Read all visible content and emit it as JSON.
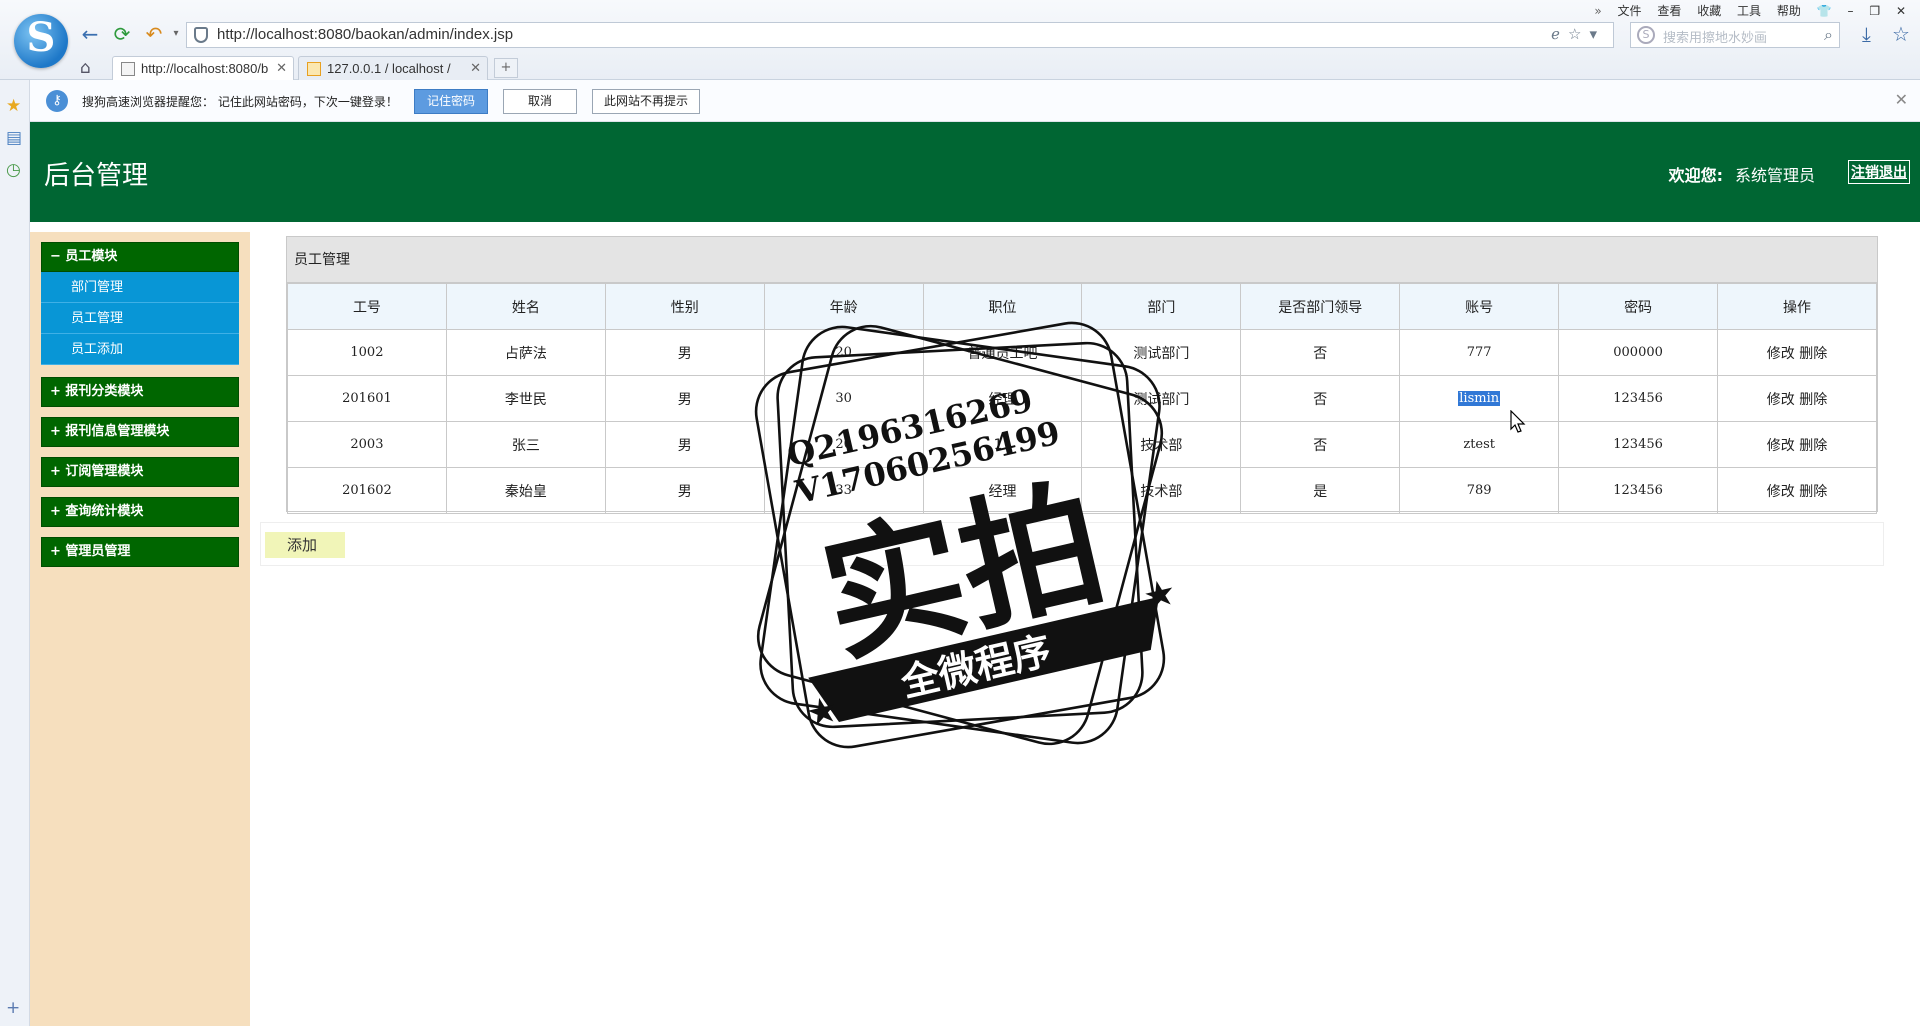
{
  "browser": {
    "url": "http://localhost:8080/baokan/admin/index.jsp",
    "search_placeholder": "搜索用擦地水妙画",
    "menu": [
      "文件",
      "查看",
      "收藏",
      "工具",
      "帮助"
    ],
    "tabs": [
      {
        "label": "http://localhost:8080/b",
        "active": true
      },
      {
        "label": "127.0.0.1 / localhost /",
        "active": false
      }
    ]
  },
  "notification": {
    "text": "搜狗高速浏览器提醒您： 记住此网站密码，下次一键登录！",
    "remember_label": "记住密码",
    "cancel_label": "取消",
    "never_label": "此网站不再提示"
  },
  "header": {
    "title": "后台管理",
    "welcome_label": "欢迎您:",
    "username": "系统管理员",
    "logout_label": "注销退出"
  },
  "sidebar": {
    "groups": [
      {
        "label": "− 员工模块",
        "items": [
          "部门管理",
          "员工管理",
          "员工添加"
        ]
      },
      {
        "label": "+ 报刊分类模块"
      },
      {
        "label": "+ 报刊信息管理模块"
      },
      {
        "label": "+ 订阅管理模块"
      },
      {
        "label": "+ 查询统计模块"
      },
      {
        "label": "+ 管理员管理"
      }
    ]
  },
  "main": {
    "panel_title": "员工管理",
    "columns": [
      "工号",
      "姓名",
      "性别",
      "年龄",
      "职位",
      "部门",
      "是否部门领导",
      "账号",
      "密码",
      "操作"
    ],
    "rows": [
      {
        "id": "1002",
        "name": "占萨法",
        "gender": "男",
        "age": "20",
        "position": "普通员工吧",
        "dept": "测试部门",
        "leader": "否",
        "account": "777",
        "password": "000000"
      },
      {
        "id": "201601",
        "name": "李世民",
        "gender": "男",
        "age": "30",
        "position": "经理",
        "dept": "测试部门",
        "leader": "否",
        "account": "lismin",
        "password": "123456"
      },
      {
        "id": "2003",
        "name": "张三",
        "gender": "男",
        "age": "20",
        "position": "11",
        "dept": "技术部",
        "leader": "否",
        "account": "ztest",
        "password": "123456"
      },
      {
        "id": "201602",
        "name": "秦始皇",
        "gender": "男",
        "age": "33",
        "position": "经理",
        "dept": "技术部",
        "leader": "是",
        "account": "789",
        "password": "123456"
      }
    ],
    "edit_label": "修改",
    "delete_label": "删除",
    "add_label": "添加"
  },
  "watermark": {
    "line1": "Q2196316269",
    "line2": "V17060256499",
    "big": "实拍",
    "banner": "全微程序"
  }
}
